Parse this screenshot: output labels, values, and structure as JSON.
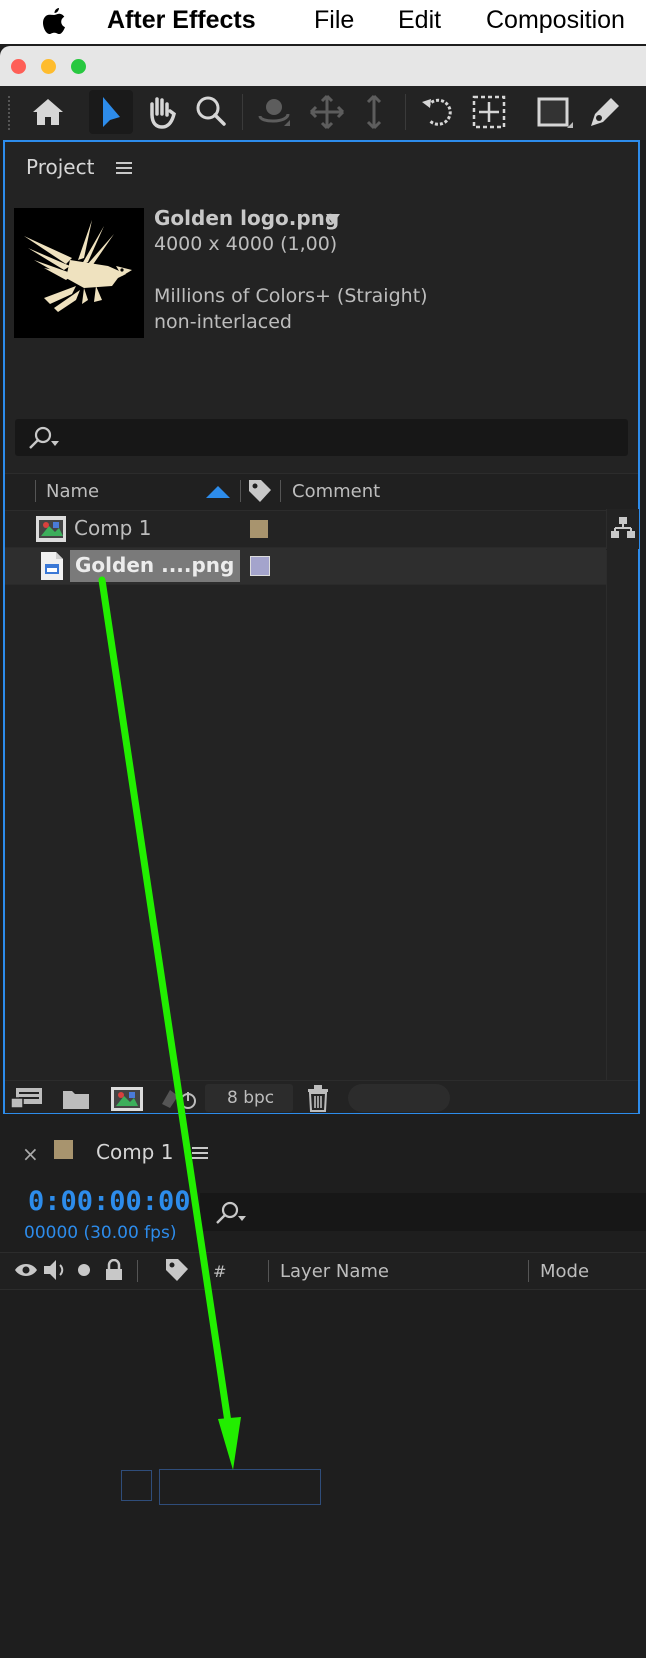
{
  "menubar": {
    "app_name": "After Effects",
    "items": [
      "File",
      "Edit",
      "Composition"
    ]
  },
  "toolbar": {
    "tools": [
      "home-icon",
      "selection-tool-icon",
      "hand-tool-icon",
      "zoom-tool-icon",
      "orbit-camera-icon",
      "pan-camera-icon",
      "dolly-camera-icon",
      "rotation-tool-icon",
      "pan-behind-icon",
      "rectangle-tool-icon",
      "pen-tool-icon"
    ]
  },
  "project": {
    "tab_label": "Project",
    "preview": {
      "name": "Golden logo.png",
      "dimensions": "4000 x 4000 (1,00)",
      "colors": "Millions of Colors+ (Straight)",
      "interlace": "non-interlaced"
    },
    "columns": {
      "name": "Name",
      "comment": "Comment"
    },
    "items": [
      {
        "name": "Comp 1",
        "type": "composition",
        "label_color": "#a8946e"
      },
      {
        "name": "Golden ....png",
        "type": "footage",
        "label_color": "#a4a4cc"
      }
    ],
    "bpc": "8 bpc"
  },
  "comp": {
    "tab_label": "Comp 1",
    "tab_color": "#a8946e",
    "timecode": "0:00:00:00",
    "frame_info": "00000 (30.00 fps)",
    "columns": {
      "number": "#",
      "layer_name": "Layer Name",
      "mode": "Mode"
    }
  },
  "colors": {
    "accent_blue": "#2d8ceb",
    "annotation_arrow": "#22ee00"
  }
}
